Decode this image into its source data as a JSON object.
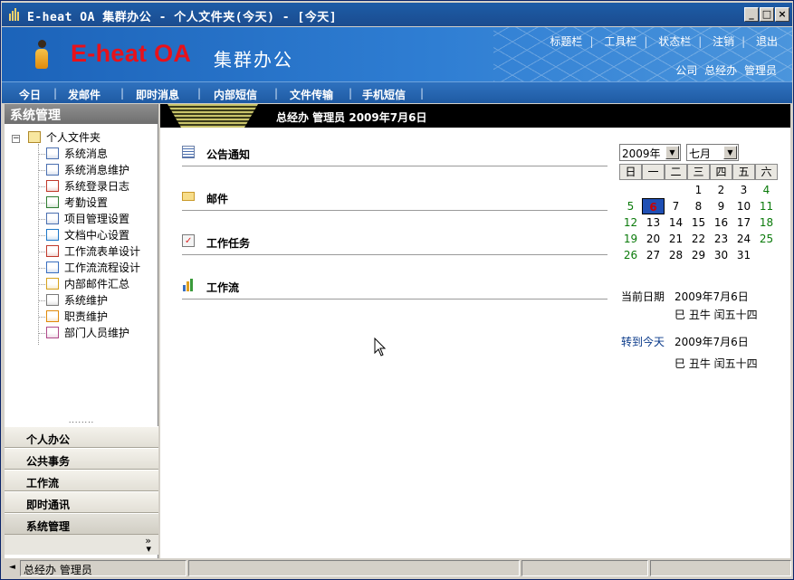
{
  "window": {
    "title": "E-heat OA 集群办公 - 个人文件夹(今天) - [今天]",
    "controls": [
      "_",
      "□",
      "×"
    ]
  },
  "header": {
    "brand": "E-heat OA",
    "brand_sub": "集群办公",
    "links": [
      "标题栏",
      "工具栏",
      "状态栏",
      "注销",
      "退出"
    ],
    "user_company": "公司",
    "user_dept": "总经办",
    "user_role": "管理员"
  },
  "nav": {
    "items": [
      "今日",
      "发邮件",
      "即时消息",
      "内部短信",
      "文件传输",
      "手机短信"
    ]
  },
  "sidebar": {
    "title": "系统管理",
    "root": "个人文件夹",
    "items": [
      {
        "label": "系统消息",
        "icon": "message-icon"
      },
      {
        "label": "系统消息维护",
        "icon": "message-maintain-icon"
      },
      {
        "label": "系统登录日志",
        "icon": "login-log-icon"
      },
      {
        "label": "考勤设置",
        "icon": "attendance-icon"
      },
      {
        "label": "项目管理设置",
        "icon": "project-icon"
      },
      {
        "label": "文档中心设置",
        "icon": "document-center-icon"
      },
      {
        "label": "工作流表单设计",
        "icon": "form-design-icon"
      },
      {
        "label": "工作流流程设计",
        "icon": "flow-design-icon"
      },
      {
        "label": "内部邮件汇总",
        "icon": "mail-icon"
      },
      {
        "label": "系统维护",
        "icon": "system-maintain-icon"
      },
      {
        "label": "职责维护",
        "icon": "duty-icon"
      },
      {
        "label": "部门人员维护",
        "icon": "department-icon"
      }
    ],
    "grip": "........",
    "accordion": [
      "个人办公",
      "公共事务",
      "工作流",
      "即时通讯",
      "系统管理"
    ],
    "more": "»"
  },
  "main": {
    "bar_text": "总经办  管理员  2009年7月6日",
    "sections": [
      "公告通知",
      "邮件",
      "工作任务",
      "工作流"
    ]
  },
  "calendar": {
    "year": "2009年",
    "month": "七月",
    "weekdays": [
      "日",
      "一",
      "二",
      "三",
      "四",
      "五",
      "六"
    ],
    "first_weekday": 3,
    "days_in_month": 31,
    "today": 6,
    "current_label": "当前日期",
    "current_date": "2009年7月6日",
    "current_lunar": "巳 丑牛 闰五十四",
    "goto_label": "转到今天",
    "goto_date": "2009年7月6日",
    "goto_lunar": "巳 丑牛 闰五十四"
  },
  "status": {
    "left_arrow": "◄",
    "user": "总经办  管理员"
  }
}
